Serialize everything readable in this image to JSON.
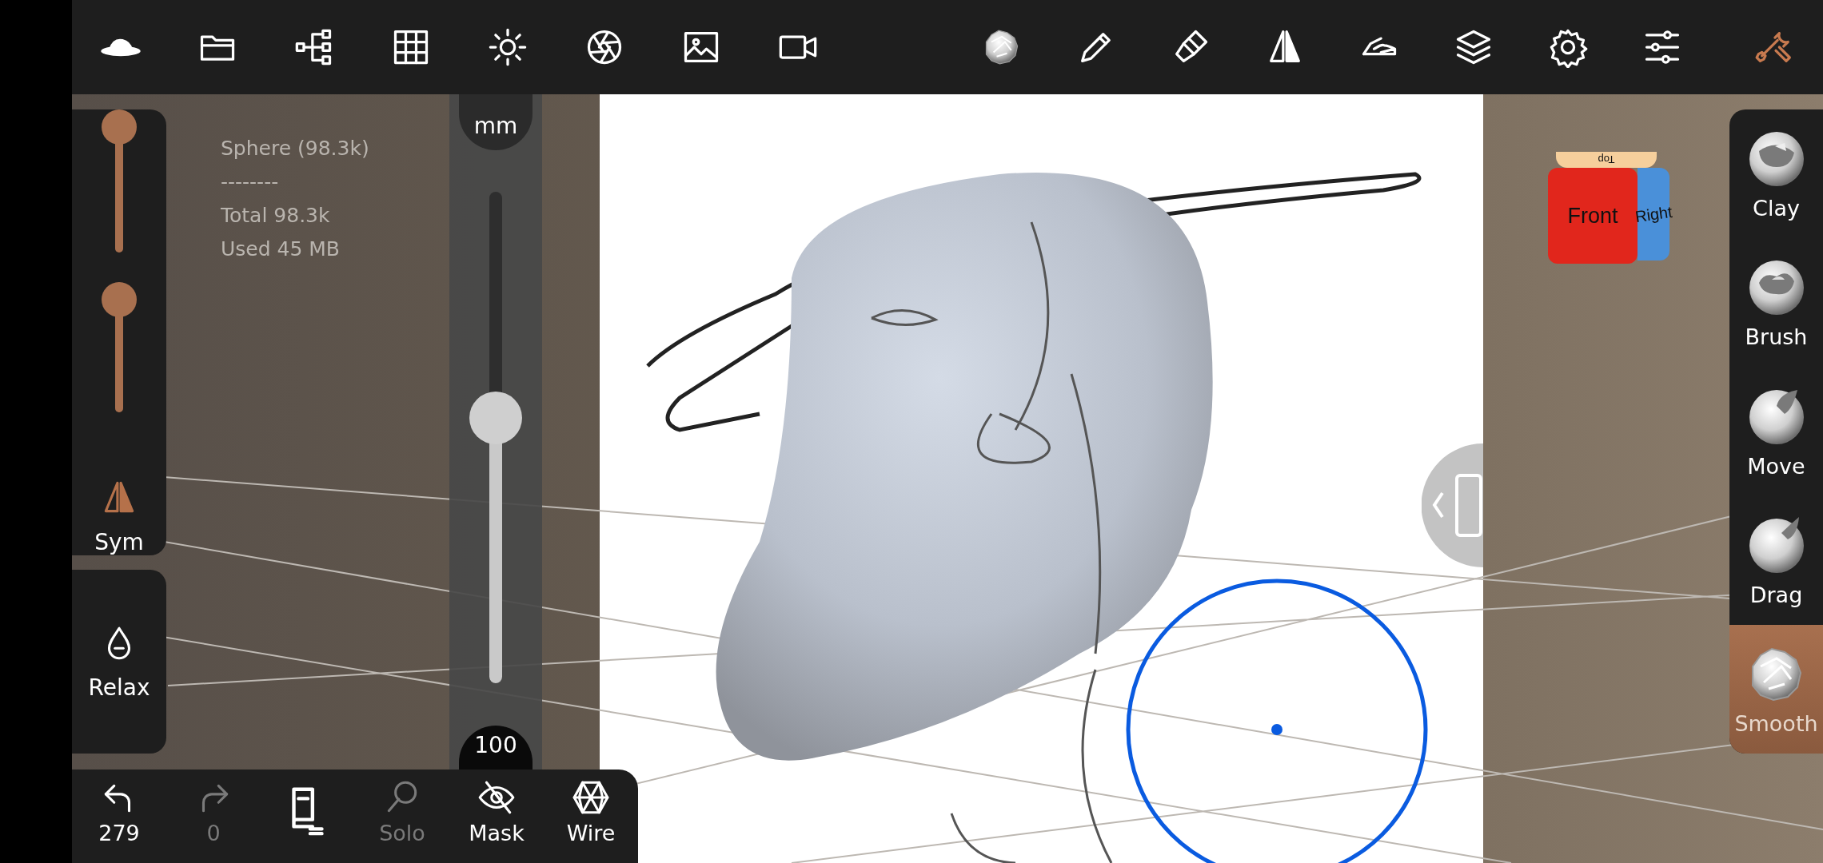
{
  "top_toolbar": {
    "left_items": [
      {
        "kind": "hat",
        "selected": false
      },
      {
        "kind": "folder",
        "selected": false
      },
      {
        "kind": "tree",
        "selected": false
      },
      {
        "kind": "grid",
        "selected": false
      },
      {
        "kind": "sun",
        "selected": false
      },
      {
        "kind": "aperture",
        "selected": false
      },
      {
        "kind": "image",
        "selected": false
      },
      {
        "kind": "camera",
        "selected": false
      }
    ],
    "right_items": [
      {
        "kind": "matcap",
        "selected": false
      },
      {
        "kind": "pen",
        "selected": false
      },
      {
        "kind": "paintbrush",
        "selected": false
      },
      {
        "kind": "mirror",
        "selected": false
      },
      {
        "kind": "hand",
        "selected": false
      },
      {
        "kind": "layers",
        "selected": false
      },
      {
        "kind": "gear",
        "selected": false
      },
      {
        "kind": "sliders",
        "selected": false
      },
      {
        "kind": "tools",
        "selected": true
      }
    ]
  },
  "left_panel": {
    "sliders": [
      {
        "level": 1
      },
      {
        "level": 0.9
      }
    ],
    "symmetry": {
      "label": "Sym",
      "on": true
    },
    "relax": {
      "label": "Relax"
    }
  },
  "stats": [
    "Sphere (98.3k)",
    "--------",
    "Total 98.3k",
    "Used 45 MB"
  ],
  "radius_slider": {
    "top_value": "mm",
    "level": 0.54,
    "bottom_value": "100"
  },
  "view_cube": {
    "front": "Front",
    "right": "Right",
    "top": "Top"
  },
  "tools": [
    {
      "kind": "clay",
      "label": "Clay",
      "selected": false
    },
    {
      "kind": "brush",
      "label": "Brush",
      "selected": false
    },
    {
      "kind": "move",
      "label": "Move",
      "selected": false
    },
    {
      "kind": "drag",
      "label": "Drag",
      "selected": false
    },
    {
      "kind": "smooth",
      "label": "Smooth",
      "selected": true
    }
  ],
  "bottom_bar": [
    {
      "kind": "undo",
      "label": "279",
      "disabled": false
    },
    {
      "kind": "redo",
      "label": "0",
      "disabled": true
    },
    {
      "kind": "scene",
      "disabled": false
    },
    {
      "kind": "solo",
      "label": "Solo",
      "disabled": true
    },
    {
      "kind": "mask",
      "label": "Mask",
      "disabled": false
    },
    {
      "kind": "wire",
      "label": "Wire",
      "disabled": false
    }
  ]
}
